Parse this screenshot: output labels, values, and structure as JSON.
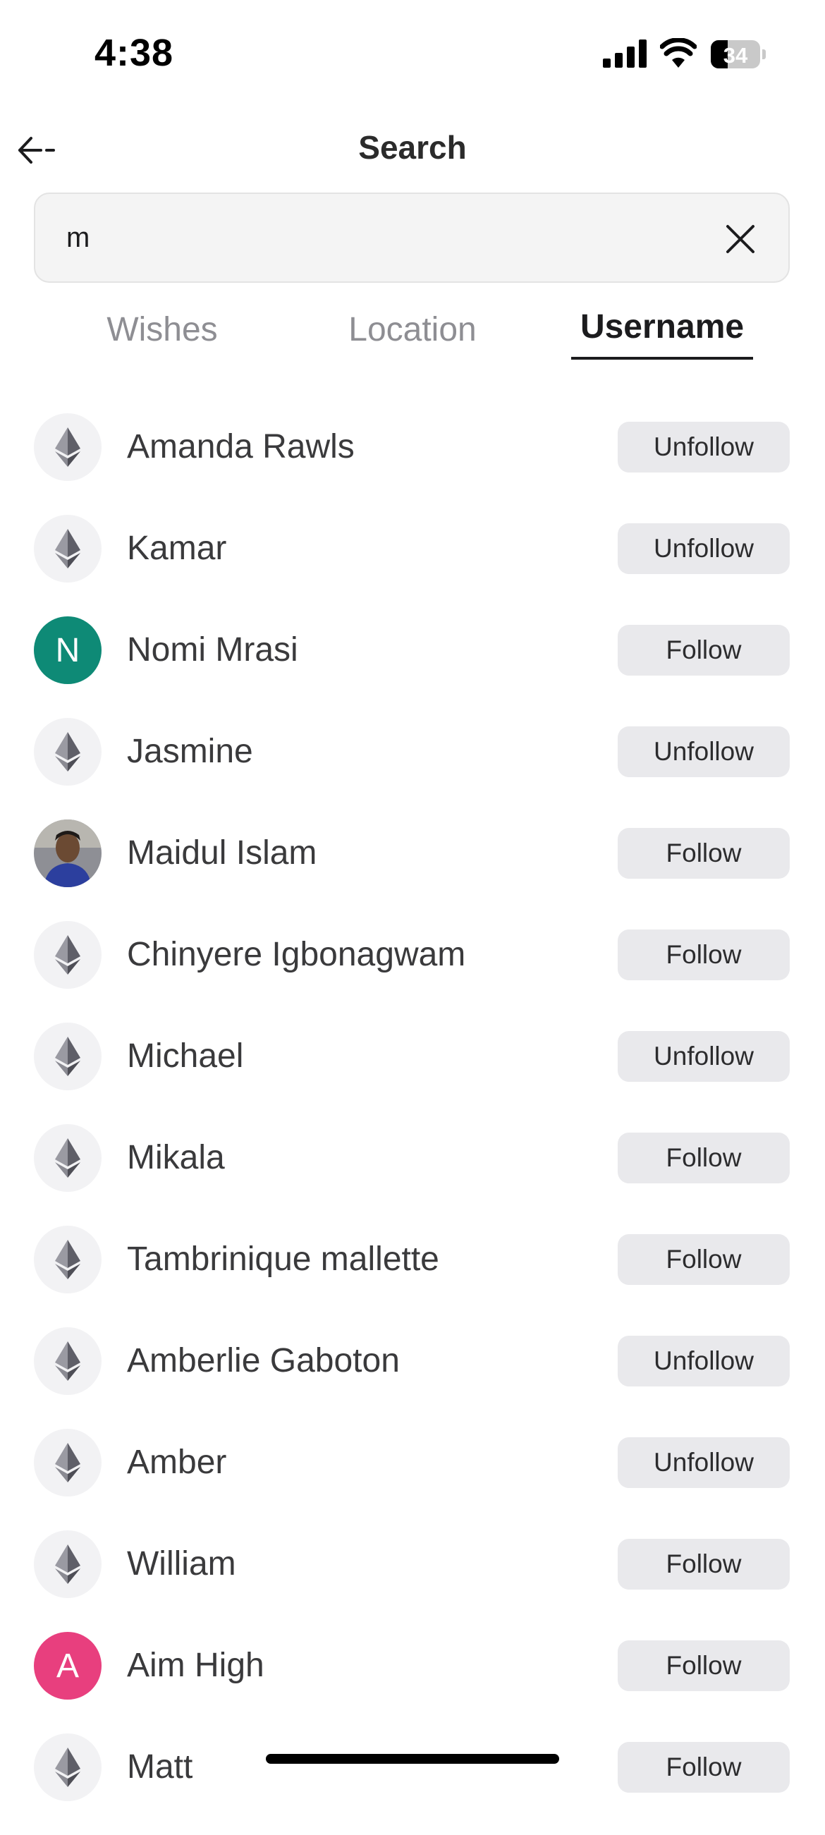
{
  "status_bar": {
    "time": "4:38",
    "battery_level": "34",
    "battery_fraction": 0.34
  },
  "header": {
    "back_label": "<-",
    "title": "Search"
  },
  "search": {
    "value": "m",
    "placeholder": ""
  },
  "tabs": [
    {
      "label": "Wishes",
      "active": false
    },
    {
      "label": "Location",
      "active": false
    },
    {
      "label": "Username",
      "active": true
    }
  ],
  "users": [
    {
      "name": "Amanda Rawls",
      "avatar": "diamond-icon",
      "action": "Unfollow"
    },
    {
      "name": "Kamar",
      "avatar": "diamond-icon",
      "action": "Unfollow"
    },
    {
      "name": "Nomi Mrasi",
      "avatar": "letter",
      "letter": "N",
      "avatar_color": "#0e8a76",
      "action": "Follow"
    },
    {
      "name": "Jasmine",
      "avatar": "diamond-icon",
      "action": "Unfollow"
    },
    {
      "name": "Maidul Islam",
      "avatar": "photo",
      "action": "Follow"
    },
    {
      "name": "Chinyere Igbonagwam",
      "avatar": "diamond-icon",
      "action": "Follow"
    },
    {
      "name": "Michael",
      "avatar": "diamond-icon",
      "action": "Unfollow"
    },
    {
      "name": "Mikala",
      "avatar": "diamond-icon",
      "action": "Follow"
    },
    {
      "name": "Tambrinique mallette",
      "avatar": "diamond-icon",
      "action": "Follow"
    },
    {
      "name": "Amberlie Gaboton",
      "avatar": "diamond-icon",
      "action": "Unfollow"
    },
    {
      "name": "Amber",
      "avatar": "diamond-icon",
      "action": "Unfollow"
    },
    {
      "name": "William",
      "avatar": "diamond-icon",
      "action": "Follow"
    },
    {
      "name": "Aim High",
      "avatar": "letter",
      "letter": "A",
      "avatar_color": "#e83f7e",
      "action": "Follow"
    },
    {
      "name": "Matt",
      "avatar": "diamond-icon",
      "action": "Follow"
    }
  ]
}
